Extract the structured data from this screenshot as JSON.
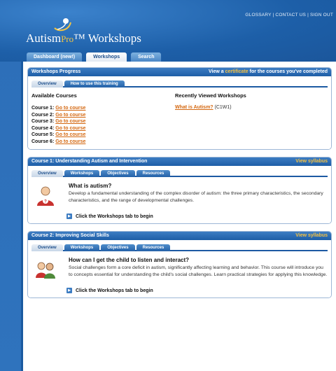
{
  "header": {
    "top_links": "GLOSSARY | CONTACT US | SIGN OUT",
    "logo_main": "Autism",
    "logo_pro": "Pro",
    "logo_tail": "Workshops"
  },
  "nav": {
    "tabs": [
      "Dashboard (new!)",
      "Workshops",
      "Search"
    ],
    "active": "Workshops"
  },
  "progress": {
    "title": "Workshops Progress",
    "right_prefix": "View a",
    "right_link": "certificate",
    "right_suffix": "for the courses you've completed",
    "tabs": [
      "Overview",
      "How to use this training"
    ],
    "available_title": "Available Courses",
    "courses": [
      {
        "label": "Course 1:",
        "link": "Go to course"
      },
      {
        "label": "Course 2:",
        "link": "Go to course"
      },
      {
        "label": "Course 3:",
        "link": "Go to course"
      },
      {
        "label": "Course 4:",
        "link": "Go to course"
      },
      {
        "label": "Course 5:",
        "link": "Go to course"
      },
      {
        "label": "Course 6:",
        "link": "Go to course"
      }
    ],
    "recent_title": "Recently Viewed Workshops",
    "recent_link": "What is Autism?",
    "recent_code": "(C1W1)"
  },
  "course1": {
    "title": "Course 1: Understanding Autism and Intervention",
    "syllabus": "View syllabus",
    "tabs": [
      "Overview",
      "Workshops",
      "Objectives",
      "Resources"
    ],
    "question": "What is autism?",
    "description": "Develop a fundamental understanding of the complex disorder of autism: the three primary characteristics, the secondary characteristics, and the range of developmental challenges.",
    "begin": "Click the Workshops tab to begin"
  },
  "course2": {
    "title": "Course 2: Improving Social Skills",
    "syllabus": "View syllabus",
    "tabs": [
      "Overview",
      "Workshops",
      "Objectives",
      "Resources"
    ],
    "question": "How can I get the child to listen and interact?",
    "description": "Social challenges form a core deficit in autism, significantly affecting learning and behavior. This course will introduce you to concepts essential for understanding the child's social challenges. Learn practical strategies for applying this knowledge.",
    "begin": "Click the Workshops tab to begin"
  },
  "colors": {
    "brand": "#1e5ea7",
    "accent": "#f6c140",
    "link": "#d4670f"
  }
}
